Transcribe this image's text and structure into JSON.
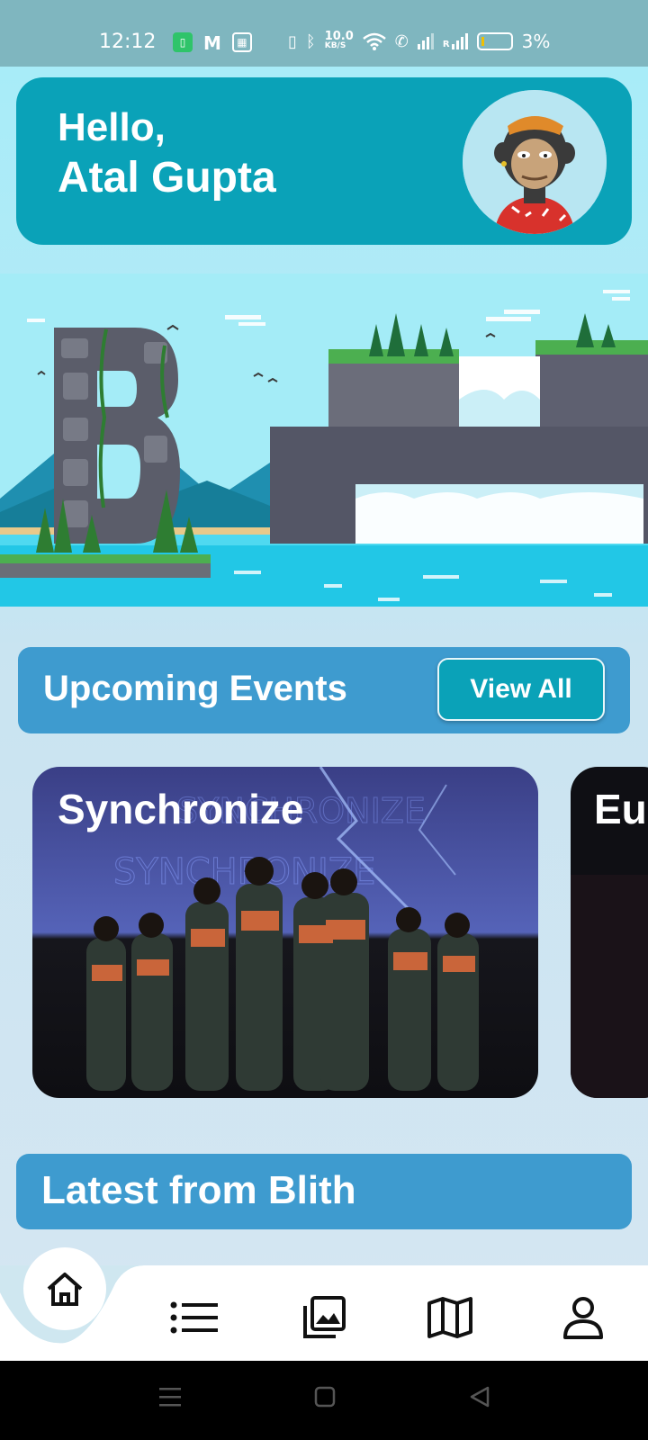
{
  "status_bar": {
    "time": "12:12",
    "net_speed_value": "10.0",
    "net_speed_unit": "KB/S",
    "roaming": "R",
    "battery": "3%",
    "icons": [
      "notification-app-icon",
      "gmail-icon",
      "gallery-icon",
      "vibrate-icon",
      "bluetooth-icon",
      "wifi-icon",
      "wifi-calling-icon",
      "signal-icon",
      "battery-icon"
    ]
  },
  "header": {
    "greeting": "Hello,",
    "user_name": "Atal Gupta",
    "avatar": "ape-avatar"
  },
  "banner": {
    "image": "illustration-letter-b-waterfall"
  },
  "events": {
    "title": "Upcoming Events",
    "view_all_label": "View All",
    "cards": [
      {
        "title": "Synchronize",
        "image": "dance-group-photo"
      },
      {
        "title": "Eu",
        "image": "event-photo-dark"
      }
    ]
  },
  "latest": {
    "title": "Latest from Blith"
  },
  "bottom_nav": {
    "items": [
      "home-icon",
      "list-icon",
      "gallery-icon",
      "map-icon",
      "profile-icon"
    ],
    "active": "home-icon"
  },
  "colors": {
    "primary_teal": "#0aa2b8",
    "section_blue": "#3e9bcf",
    "status_bar": "#7fb6bf"
  }
}
